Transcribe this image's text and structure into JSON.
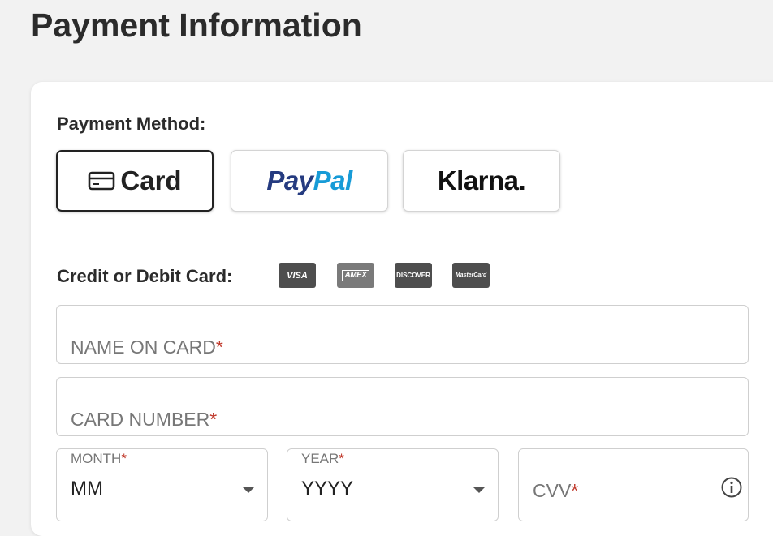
{
  "page": {
    "title": "Payment Information"
  },
  "payment_method": {
    "label": "Payment Method:",
    "selected": "Card",
    "options": [
      {
        "id": "card",
        "label": "Card",
        "icon": "credit-card-icon"
      },
      {
        "id": "paypal",
        "label_part1": "Pay",
        "label_part2": "Pal"
      },
      {
        "id": "klarna",
        "label": "Klarna."
      }
    ]
  },
  "card_section": {
    "label": "Credit or Debit Card:",
    "brands": [
      "VISA",
      "AMEX",
      "DISCOVER",
      "MasterCard"
    ]
  },
  "fields": {
    "name": {
      "placeholder": "NAME ON CARD",
      "required_mark": "*"
    },
    "number": {
      "placeholder": "CARD NUMBER",
      "required_mark": "*"
    },
    "month": {
      "label": "MONTH",
      "required_mark": "*",
      "value": "MM"
    },
    "year": {
      "label": "YEAR",
      "required_mark": "*",
      "value": "YYYY"
    },
    "cvv": {
      "placeholder": "CVV",
      "required_mark": "*",
      "icon": "info-icon"
    }
  },
  "colors": {
    "background": "#f2f2f2",
    "paypal_dark": "#253b80",
    "paypal_light": "#179bd7",
    "required": "#c0392b"
  }
}
